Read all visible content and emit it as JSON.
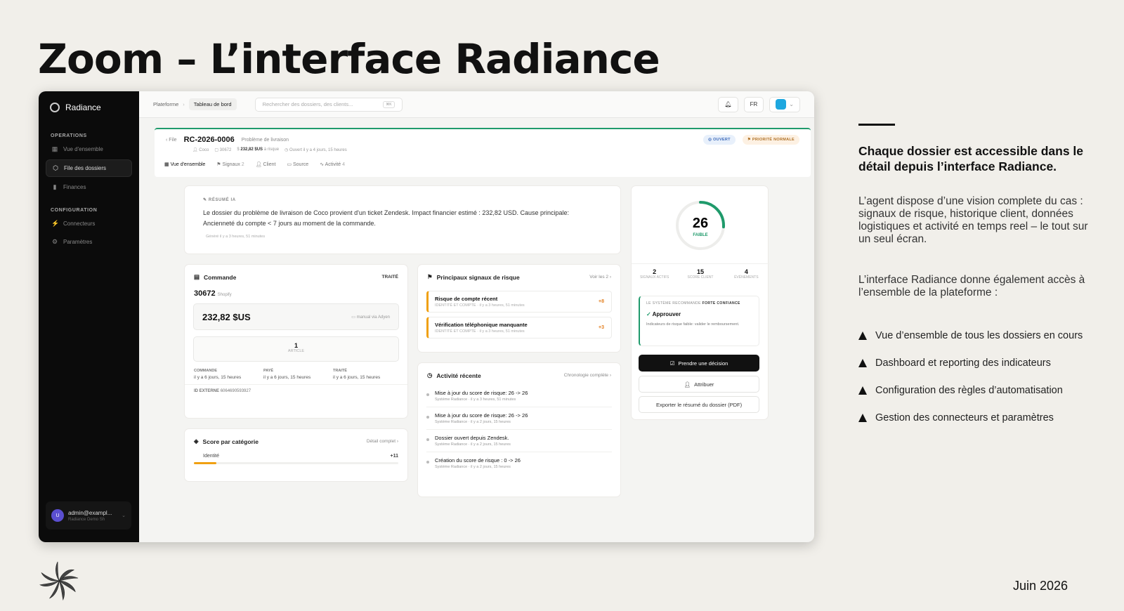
{
  "slide": {
    "title": "Zoom – L’interface Radiance",
    "heading": "Chaque dossier est accessible dans le détail depuis l’interface Radiance.",
    "para1": "L’agent dispose d’une vision complete du cas : signaux de risque, historique client, données logistiques et activité en temps reel – le tout sur un seul écran.",
    "para2": "L’interface Radiance donne également accès à l’ensemble de la plateforme :",
    "bullets": [
      "Vue d’ensemble de tous les dossiers en cours",
      "Dashboard et reporting des indicateurs",
      "Configuration des règles d’automatisation",
      "Gestion des connecteurs et paramètres"
    ],
    "date": "Juin 2026"
  },
  "sidebar": {
    "brand": "Radiance",
    "section_ops": "OPERATIONS",
    "items_ops": [
      "Vue d'ensemble",
      "File des dossiers",
      "Finances"
    ],
    "section_conf": "CONFIGURATION",
    "items_conf": [
      "Connecteurs",
      "Paramètres"
    ],
    "user_name": "admin@exampl...",
    "user_org": "Radiance Demo Sh",
    "user_initial": "U"
  },
  "topbar": {
    "crumb_root": "Plateforme",
    "crumb_current": "Tableau de bord",
    "search_placeholder": "Rechercher des dossiers, des clients...",
    "search_kbd": "⌘K",
    "lang": "FR"
  },
  "case": {
    "back": "File",
    "id": "RC-2026-0006",
    "type": "Problème de livraison",
    "customer": "Coco",
    "order": "30672",
    "amount": "232,82 $US",
    "amount_note": "à risque",
    "opened": "Ouvert il y a 4 jours, 15 heures",
    "status": "OUVERT",
    "priority": "PRIORITÉ NORMALE",
    "tabs": [
      {
        "label": "Vue d'ensemble",
        "count": ""
      },
      {
        "label": "Signaux",
        "count": "2"
      },
      {
        "label": "Client",
        "count": ""
      },
      {
        "label": "Source",
        "count": ""
      },
      {
        "label": "Activité",
        "count": "4"
      }
    ]
  },
  "ai_summary": {
    "label": "RÉSUMÉ IA",
    "text": "Le dossier du problème de livraison de Coco provient d'un ticket Zendesk. Impact financier estimé : 232,82 USD. Cause principale: Ancienneté du compte < 7 jours au moment de la commande.",
    "generated": "Généré il y a 3 heures, 51 minutes"
  },
  "order_card": {
    "title": "Commande",
    "status": "TRAITÉ",
    "number": "30672",
    "platform": "Shopify",
    "amount": "232,82 $US",
    "payment": "manual via Adyen",
    "articles": "1",
    "articles_label": "ARTICLE",
    "dates": [
      {
        "label": "COMMANDE",
        "value": "il y a 6 jours, 15 heures"
      },
      {
        "label": "PAYÉ",
        "value": "il y a 6 jours, 15 heures"
      },
      {
        "label": "TRAITÉ",
        "value": "il y a 6 jours, 15 heures"
      }
    ],
    "external_label": "ID EXTERNE",
    "external_id": "6064690593927"
  },
  "signals_card": {
    "title": "Principaux signaux de risque",
    "link": "Voir les 2",
    "items": [
      {
        "title": "Risque de compte récent",
        "sub": "IDENTITÉ ET COMPTE · il y a 3 heures, 51 minutes",
        "delta": "+8"
      },
      {
        "title": "Vérification téléphonique manquante",
        "sub": "IDENTITÉ ET COMPTE · il y a 3 heures, 51 minutes",
        "delta": "+3"
      }
    ]
  },
  "activity_card": {
    "title": "Activité récente",
    "link": "Chronologie complète",
    "items": [
      {
        "title": "Mise à jour du score de risque: 26 -> 26",
        "sub": "Système Radiance · il y a 3 heures, 51 minutes"
      },
      {
        "title": "Mise à jour du score de risque: 26 -> 26",
        "sub": "Système Radiance · il y a 2 jours, 15 heures"
      },
      {
        "title": "Dossier ouvert depuis Zendesk.",
        "sub": "Système Radiance · il y a 2 jours, 15 heures"
      },
      {
        "title": "Création du score de risque : 0 -> 26",
        "sub": "Système Radiance · il y a 2 jours, 15 heures"
      }
    ]
  },
  "score_card": {
    "title": "Score par catégorie",
    "link": "Détail complet",
    "category": "Identité",
    "value": "+11",
    "fill": 0.11
  },
  "risk_panel": {
    "score": "26",
    "score_value": 26,
    "score_label": "FAIBLE",
    "stats": [
      {
        "value": "2",
        "label": "SIGNAUX ACTIFS"
      },
      {
        "value": "15",
        "label": "SCORE CLIENT"
      },
      {
        "value": "4",
        "label": "ÉVÉNEMENTS"
      }
    ],
    "rec_label": "LE SYSTÈME RECOMMANDE",
    "confidence": "FORTE CONFIANCE",
    "decision": "Approuver",
    "rec_text": "Indicateurs de risque faible: valider le remboursement.",
    "btn_decide": "Prendre une décision",
    "btn_assign": "Attribuer",
    "btn_export": "Exporter le résumé du dossier (PDF)"
  },
  "colors": {
    "accent": "#1f9a6b",
    "warning": "#f0a012",
    "dark": "#0b0b0b"
  }
}
